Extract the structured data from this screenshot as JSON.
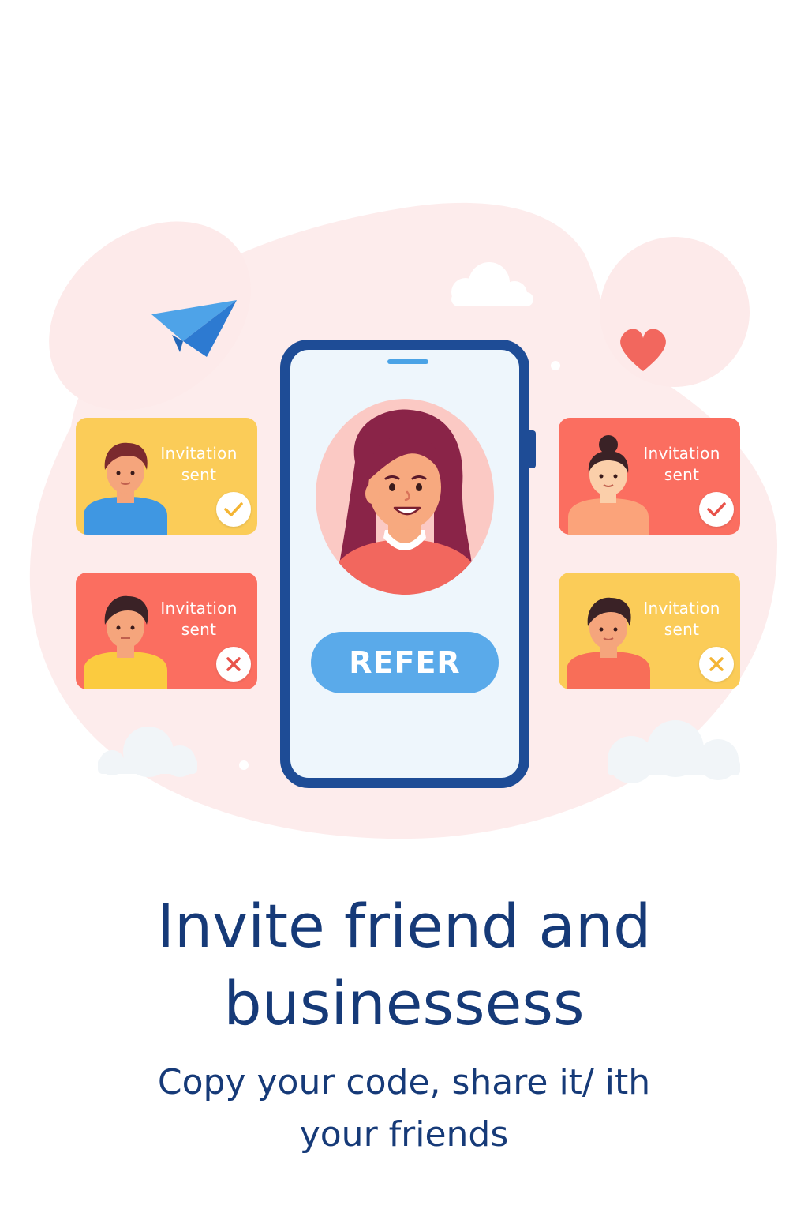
{
  "illustration": {
    "cards": [
      {
        "label": "Invitation\nsent",
        "status": "check",
        "card_color": "#fbcc58",
        "shirt_color": "#3f97e2"
      },
      {
        "label": "Invitation\nsent",
        "status": "check",
        "card_color": "#fb6e60",
        "shirt_color": "#fba37a"
      },
      {
        "label": "Invitation\nsent",
        "status": "cross",
        "card_color": "#fb6e60",
        "shirt_color": "#fbcb3f"
      },
      {
        "label": "Invitation\nsent",
        "status": "cross",
        "card_color": "#fbcc58",
        "shirt_color": "#f86e58"
      }
    ],
    "phone": {
      "refer_label": "REFER"
    }
  },
  "content": {
    "headline": "Invite friend and\nbusinessess",
    "subtext": "Copy your code, share it/ ith\nyour friends"
  },
  "colors": {
    "brand_navy": "#163a78",
    "phone_frame": "#1e4c96",
    "button_blue": "#5aaaea",
    "blob_pink": "#fdecec",
    "heart_red": "#f2675e",
    "check_yellow": "#f4b534",
    "check_red": "#e8524a"
  }
}
